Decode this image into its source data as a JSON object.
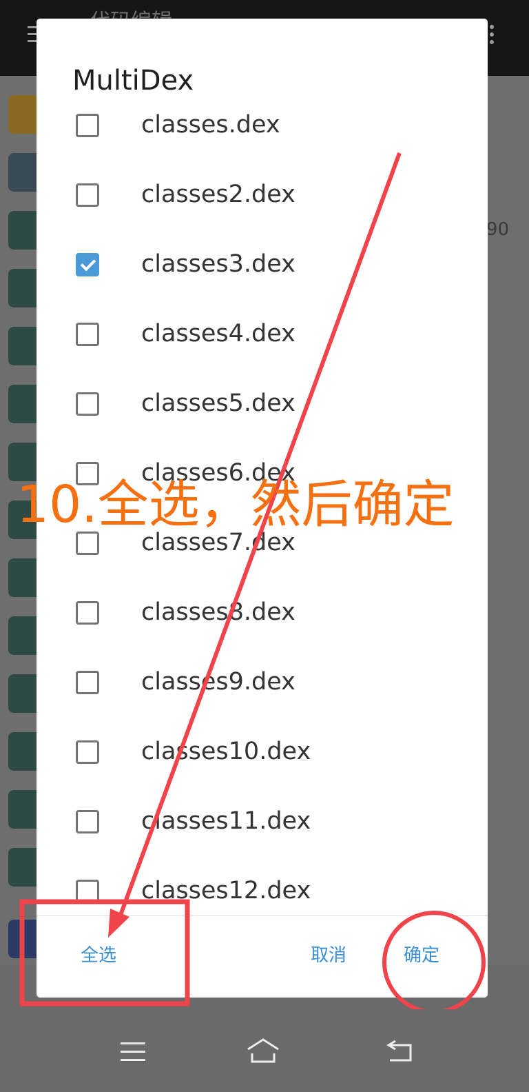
{
  "app": {
    "title": "代码编辑",
    "title_suffix": "90"
  },
  "dialog": {
    "title": "MultiDex",
    "items": [
      {
        "label": "classes.dex",
        "checked": false
      },
      {
        "label": "classes2.dex",
        "checked": false
      },
      {
        "label": "classes3.dex",
        "checked": true
      },
      {
        "label": "classes4.dex",
        "checked": false
      },
      {
        "label": "classes5.dex",
        "checked": false
      },
      {
        "label": "classes6.dex",
        "checked": false
      },
      {
        "label": "classes7.dex",
        "checked": false
      },
      {
        "label": "classes8.dex",
        "checked": false
      },
      {
        "label": "classes9.dex",
        "checked": false
      },
      {
        "label": "classes10.dex",
        "checked": false
      },
      {
        "label": "classes11.dex",
        "checked": false
      },
      {
        "label": "classes12.dex",
        "checked": false
      }
    ],
    "select_all_label": "全选",
    "cancel_label": "取消",
    "ok_label": "确定"
  },
  "annotation": {
    "text": "10.全选，然后确定",
    "text_color": "#f57011",
    "mark_color": "#f0444a"
  },
  "icons": [
    "menu-icon",
    "overflow-icon",
    "layers-icon",
    "file-icon",
    "binary-file-icon",
    "recents-icon",
    "home-icon",
    "back-icon"
  ],
  "colors": {
    "accent": "#3a8fd0",
    "checkbox_checked": "#4a9ad8"
  }
}
